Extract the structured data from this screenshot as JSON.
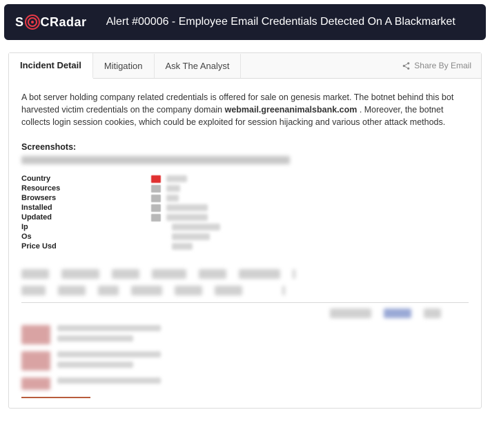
{
  "brand": {
    "name_pre": "S",
    "name_post": "CRadar"
  },
  "header": {
    "title": "Alert #00006 - Employee Email Credentials Detected On A Blackmarket"
  },
  "tabs": {
    "items": [
      {
        "label": "Incident Detail",
        "active": true
      },
      {
        "label": "Mitigation",
        "active": false
      },
      {
        "label": "Ask The Analyst",
        "active": false
      }
    ],
    "share_label": "Share By Email"
  },
  "incident": {
    "description_pre": "A bot server holding company related credentials is offered for sale on genesis market. The botnet behind this bot harvested victim credentials on the company domain ",
    "description_bold": "webmail.greenanimalsbank.com",
    "description_post": " . Moreover, the botnet collects login session cookies, which could be exploited for session hijacking and various other attack methods.",
    "screenshots_heading": "Screenshots:",
    "fields": [
      {
        "label": "Country"
      },
      {
        "label": "Resources"
      },
      {
        "label": "Browsers"
      },
      {
        "label": "Installed"
      },
      {
        "label": "Updated"
      },
      {
        "label": "Ip"
      },
      {
        "label": "Os"
      },
      {
        "label": "Price Usd"
      }
    ]
  }
}
